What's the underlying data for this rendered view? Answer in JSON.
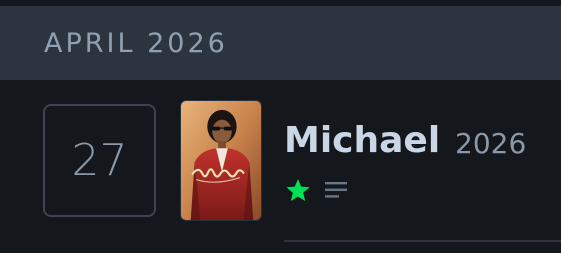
{
  "month_header": {
    "label": "APRIL 2026"
  },
  "entry": {
    "day": "27",
    "film": {
      "title": "Michael",
      "year": "2026",
      "poster_icon": "film-poster-thumbnail"
    },
    "liked": true,
    "has_review": true,
    "icons": {
      "like": "star-icon",
      "review": "review-lines-icon"
    }
  },
  "colors": {
    "background": "#14181c",
    "header_background": "#2c3440",
    "accent_green": "#00e054",
    "title_text": "#c8d6e5",
    "muted_text": "#8a98a8"
  }
}
